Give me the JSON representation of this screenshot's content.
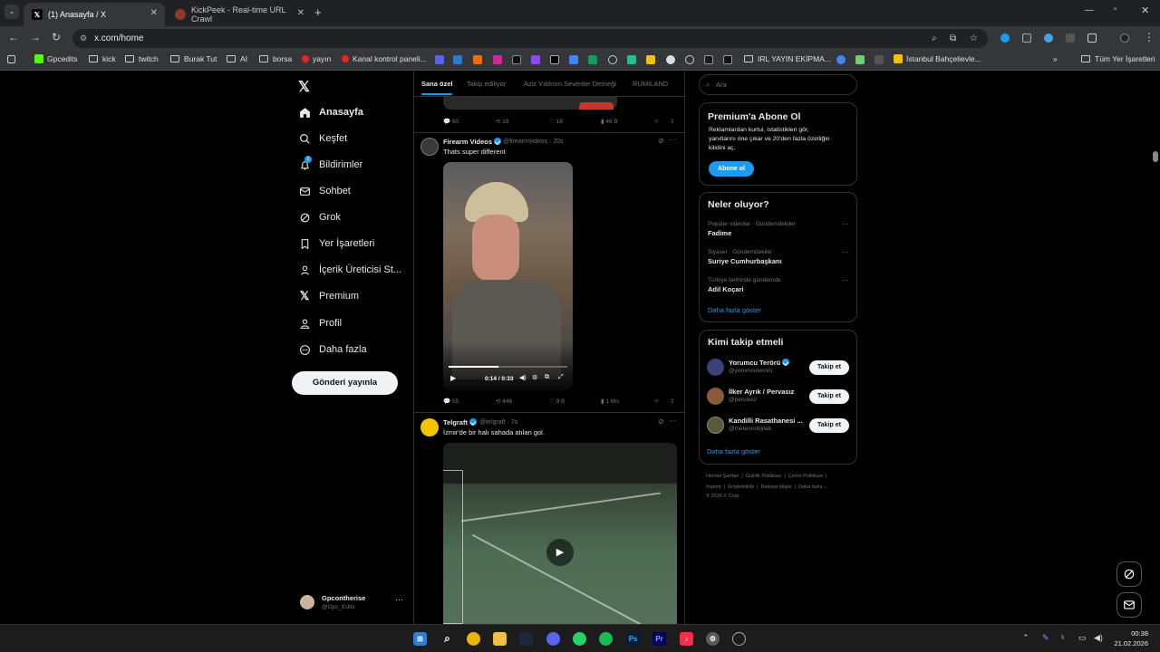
{
  "browser": {
    "tabs": [
      {
        "title": "(1) Anasayfa / X",
        "icon": "x-logo-icon"
      },
      {
        "title": "KickPeek - Real-time URL Crawl",
        "icon": "kickpeek-icon"
      }
    ],
    "url": "x.com/home",
    "bookmarks": [
      "Gpcedits",
      "kick",
      "twitch",
      "Burak Tut",
      "AI",
      "borsa",
      "yayın",
      "Kanal kontrol paneli...",
      "IRL YAYIN EKİPMA...",
      "İstanbul Bahçelievle..."
    ],
    "all_bookmarks": "Tüm Yer İşaretleri"
  },
  "x": {
    "nav": [
      "Anasayfa",
      "Keşfet",
      "Bildirimler",
      "Sohbet",
      "Grok",
      "Yer İşaretleri",
      "İçerik Üreticisi St...",
      "Premium",
      "Profil",
      "Daha fazla"
    ],
    "notification_badge": "1",
    "post_button": "Gönderi yayınla",
    "account": {
      "name": "Gpcontherise",
      "handle": "@Gpc_Edits"
    },
    "feed_tabs": [
      "Sana özel",
      "Takip ediliyor",
      "Aziz Yıldırım Sevenler Derneği",
      "RUMILAND"
    ],
    "prev_post": {
      "replies": "60",
      "reposts": "19",
      "likes": "18",
      "views": "46 B"
    },
    "posts": [
      {
        "name": "Firearm Videos",
        "handle": "@firearmvideos",
        "time": "· 20s",
        "text": "Thats super different",
        "video_time": "0:14 / 0:33",
        "replies": "55",
        "reposts": "446",
        "likes": "9 B",
        "views": "1 Mn"
      },
      {
        "name": "Telgraft",
        "handle": "@telgraft",
        "time": "· 7s",
        "text": "İzmir'de bir halı sahada atılan gol."
      }
    ]
  },
  "sidebar": {
    "search_placeholder": "Ara",
    "premium": {
      "title": "Premium'a Abone Ol",
      "body_lines": [
        "Reklamlardan kurtul, istatistikleri gör,",
        "yanıtlarını öne çıkar ve 20'den fazla özelliğin",
        "kilidini aç."
      ],
      "button": "Abone ol"
    },
    "trends_title": "Neler oluyor?",
    "trends": [
      {
        "context": "Popüler videolar · Gündemdekiler",
        "name": "Fadime"
      },
      {
        "context": "Siyaset · Gündemdekiler",
        "name": "Suriye Cumhurbaşkanı"
      },
      {
        "context": "Türkiye tarihinde gündemde",
        "name": "Adil Koçari"
      }
    ],
    "show_more": "Daha fazla göster",
    "who_title": "Kimi takip etmeli",
    "who": [
      {
        "name": "Yorumcu Terörü",
        "handle": "@yorumcuteroru",
        "verified": true
      },
      {
        "name": "İlker Ayrık / Pervasız",
        "handle": "@pervasiz",
        "verified": false
      },
      {
        "name": "Kandilli Rasathanesi ...",
        "handle": "@meteorolojilab",
        "verified": false
      }
    ],
    "follow_label": "Takip et",
    "footer": [
      "Hizmet Şartları",
      "Gizlilik Politikası",
      "Çerez Politikası",
      "Imprint",
      "Erişilebilirlik",
      "Reklam bilgisi",
      "Daha fazla ...",
      "© 2026 X Corp."
    ]
  },
  "taskbar": {
    "time": "00:38",
    "date": "21.02.2026"
  },
  "colors": {
    "accent": "#1d9bf0",
    "background": "#000000",
    "chrome": "#35363a"
  }
}
